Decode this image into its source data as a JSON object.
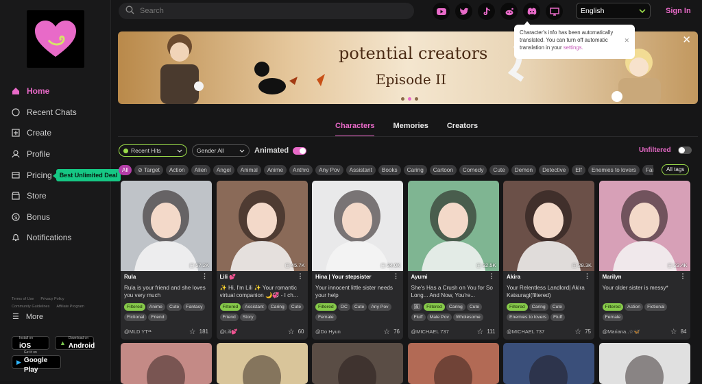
{
  "search": {
    "placeholder": "Search"
  },
  "sidebar": {
    "items": [
      {
        "label": "Home",
        "icon": "home-icon"
      },
      {
        "label": "Recent Chats",
        "icon": "chat-icon"
      },
      {
        "label": "Create",
        "icon": "plus-square-icon"
      },
      {
        "label": "Profile",
        "icon": "user-icon"
      },
      {
        "label": "Pricing",
        "icon": "pricing-icon"
      },
      {
        "label": "Store",
        "icon": "store-icon"
      },
      {
        "label": "Bonus",
        "icon": "dollar-icon"
      },
      {
        "label": "Notifications",
        "icon": "bell-icon"
      }
    ],
    "deal_badge": "Best Unlimited Deal",
    "footer_links": [
      "Terms of Use",
      "Privacy Policy",
      "Community Guidelines",
      "Affiliate Program"
    ],
    "more": "More",
    "ios": {
      "small": "Install on",
      "big": "iOS",
      "small2": "device"
    },
    "android": {
      "small": "Download on",
      "big": "Android"
    },
    "google": {
      "small": "Get it on",
      "big": "Google Play"
    }
  },
  "header": {
    "socials": [
      "youtube-icon",
      "twitter-icon",
      "tiktok-icon",
      "reddit-icon",
      "discord-icon",
      "monitor-icon"
    ],
    "language": "English",
    "signin": "Sign In"
  },
  "toast": {
    "text": "Character's info has been automatically translated. You can turn off automatic translation in your ",
    "link": "settings."
  },
  "banner": {
    "line1": "potential creators",
    "line2": "Episode II"
  },
  "tabs": [
    "Characters",
    "Memories",
    "Creators"
  ],
  "filters": {
    "recent": "Recent Hits",
    "gender": "Gender All",
    "animated": "Animated",
    "unfiltered": "Unfiltered"
  },
  "tags": [
    "All",
    "Target",
    "Action",
    "Alien",
    "Angel",
    "Animal",
    "Anime",
    "Anthro",
    "Any Pov",
    "Assistant",
    "Books",
    "Caring",
    "Cartoon",
    "Comedy",
    "Cute",
    "Demon",
    "Detective",
    "Elf",
    "Enemies to lovers",
    "Fairytale"
  ],
  "all_tags": "All tags",
  "cards": [
    {
      "name": "Rula",
      "views": "57.2K",
      "desc": "Rula is your friend and she loves you very much",
      "tags": [
        "Filtered",
        "Anime",
        "Cute",
        "Fantasy",
        "Fictional",
        "Friend"
      ],
      "author": "@MLD YT³¹",
      "favs": "181",
      "color": "#bfc3c8"
    },
    {
      "name": "Lili 💕",
      "views": "45.7K",
      "desc": "✨ Hi, I'm Lili ✨ Your romantic virtual companion 🌙💞 - I ch...",
      "tags": [
        "Filtered",
        "Assistant",
        "Caring",
        "Cute",
        "Friend",
        "Story"
      ],
      "author": "@Lili💕",
      "favs": "60",
      "color": "#8a6a58"
    },
    {
      "name": "Hina | Your stepsister",
      "views": "34.0K",
      "desc": "Your innocent little sister needs your help",
      "tags": [
        "Filtered",
        "OC",
        "Cute",
        "Any Pov",
        "Female"
      ],
      "author": "@Do Hyun",
      "favs": "76",
      "color": "#e9e9ea"
    },
    {
      "name": "Ayumi",
      "views": "32.5K",
      "desc": "She's Has a Crush on You for So Long... And Now, You're...",
      "tags": [
        "🖼",
        "Filtered",
        "Caring",
        "Cute",
        "Fluff",
        "Male Pov",
        "Wholesome"
      ],
      "author": "@MICHAEL 737",
      "favs": "111",
      "color": "#7fb592"
    },
    {
      "name": "Akira",
      "views": "28.3K",
      "desc": "Your Relentless Landlord| Akira Katsuragi(filtered)",
      "tags": [
        "Filtered",
        "Caring",
        "Cute",
        "Enemies to lovers",
        "Fluff"
      ],
      "author": "@MICHAEL 737",
      "favs": "75",
      "color": "#6b5048"
    },
    {
      "name": "Marilyn",
      "views": "23.4K",
      "desc": "Your older sister is messy*",
      "tags": [
        "Filtered",
        "Action",
        "Fictional",
        "Female"
      ],
      "author": "@Mariana..☆🦋",
      "favs": "84",
      "color": "#d7a0b7"
    }
  ],
  "row2_colors": [
    "#c48a86",
    "#d9c59a",
    "#5a4d45",
    "#b26a55",
    "#3a4f7a",
    "#e0e0e0"
  ]
}
